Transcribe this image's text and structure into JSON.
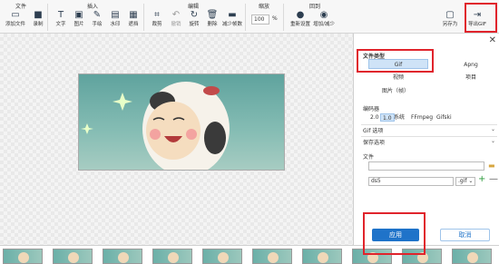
{
  "groups": {
    "file": "文件",
    "insert": "插入",
    "edit": "编辑",
    "zoom": "缩放",
    "reset": "回到"
  },
  "toolbar": {
    "add_file": "添加文件",
    "record": "录制",
    "text": "文字",
    "image": "图片",
    "hand": "手绘",
    "watermark": "水印",
    "mosaic": "遮挡",
    "crop": "裁剪",
    "undo": "撤销",
    "rotate": "旋转",
    "delete": "删除",
    "reduce_frames": "减少帧数",
    "zoom_value": "100",
    "zoom_unit": "%",
    "reset_settings": "重新设置",
    "add_reduce": "增加/减少",
    "save_as": "另存为",
    "export_gif": "导出GIF"
  },
  "panel": {
    "file_type": "文件类型",
    "gif": "Gif",
    "apng": "Apng",
    "video": "视频",
    "project": "项目",
    "image_frame": "图片（帧）",
    "encoder": "编码器",
    "enc_20": "2.0",
    "enc_10": "1.0",
    "enc_system": "系统",
    "enc_ffmpeg": "FFmpeg",
    "enc_gifski": "Gifski",
    "gif_options": "Gif 选项",
    "save_options": "保存选项",
    "file": "文件",
    "filename": "ds5",
    "ext": ".gif"
  },
  "buttons": {
    "apply": "应用",
    "cancel": "取消"
  },
  "colors": {
    "accent": "#1f73c9",
    "highlight": "#e0242c"
  }
}
